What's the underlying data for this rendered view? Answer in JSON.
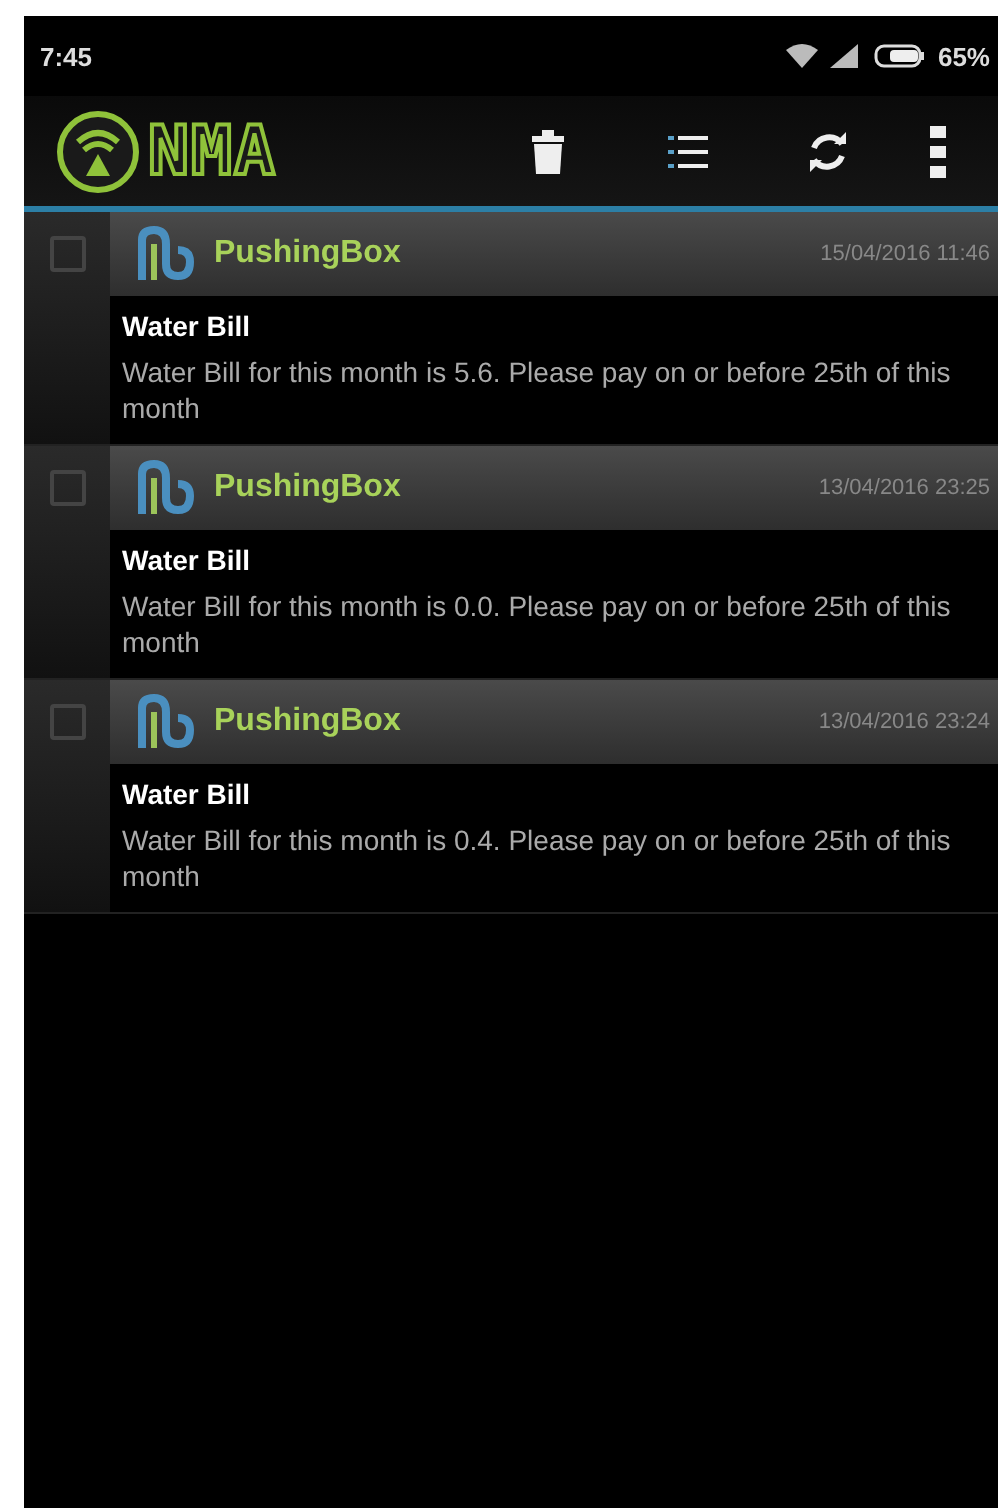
{
  "status_bar": {
    "time": "7:45",
    "battery": "65%"
  },
  "app_bar": {
    "logo_text": "NMA"
  },
  "messages": [
    {
      "app": "PushingBox",
      "date": "15/04/2016 11:46",
      "title": "Water Bill",
      "body": "Water Bill for this month is 5.6. Please pay on or before 25th of this month",
      "checked": false
    },
    {
      "app": "PushingBox",
      "date": "13/04/2016 23:25",
      "title": "Water Bill",
      "body": "Water Bill for this month is 0.0. Please pay on or before 25th of this month",
      "checked": false
    },
    {
      "app": "PushingBox",
      "date": "13/04/2016 23:24",
      "title": "Water Bill",
      "body": "Water Bill for this month is 0.4. Please pay on or before 25th of this month",
      "checked": false
    }
  ]
}
